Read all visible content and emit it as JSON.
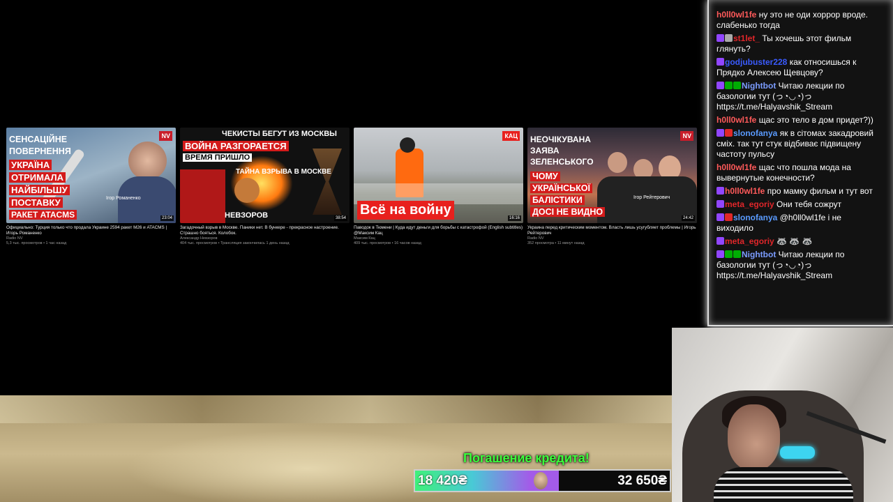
{
  "videos": [
    {
      "duration": "23:04",
      "badge": "NV",
      "thumb_lines": [
        "СЕНСАЦІЙНЕ",
        "ПОВЕРНЕННЯ",
        "УКРАЇНА",
        "ОТРИМАЛА",
        "НАЙБІЛЬШУ",
        "ПОСТАВКУ",
        "РАКЕТ ATACMS"
      ],
      "thumb_caption": "Ігор Романенко",
      "title": "Официально: Турция только что продала Украине 2594 ракет M26 и ATACMS | Игорь Романенко",
      "channel": "Radio NV",
      "meta": "5,3 тыс. просмотров • 1 час назад"
    },
    {
      "duration": "38:54",
      "thumb_lines": [
        "ЧЕКИСТЫ БЕГУТ ИЗ МОСКВЫ",
        "ВОЙНА РАЗГОРАЕТСЯ",
        "ВРЕМЯ ПРИШЛО",
        "ТАЙНА ВЗРЫВА В МОСКВЕ",
        "НЕВЗОРОВ"
      ],
      "title": "Загадочный взрыв в Москве. Паники нет. В бункере - прекрасное настроение. Страшно бояться. Колобок.",
      "channel": "Александр Невзоров",
      "meta": "404 тыс. просмотров • Трансляция закончилась 1 день назад"
    },
    {
      "duration": "16:16",
      "badge": "КАЦ",
      "thumb_lines": [
        "Всё на войну"
      ],
      "title": "Паводок в Тюмени | Куда идут деньги для борьбы с катастрофой (English subtitles) @Максим Кац",
      "channel": "Максим Кац",
      "meta": "409 тыс. просмотров • 16 часов назад"
    },
    {
      "duration": "24:42",
      "badge": "NV",
      "thumb_lines": [
        "НЕОЧІКУВАНА",
        "ЗАЯВА",
        "ЗЕЛЕНСЬКОГО",
        "ЧОМУ",
        "УКРАЇНСЬКОЇ",
        "БАЛІСТИКИ",
        "ДОСІ НЕ ВИДНО"
      ],
      "thumb_caption": "Ігор Рейтерович",
      "title": "Украина перед критическим моментом. Власть лишь усугубляет проблемы | Игорь Рейтерович",
      "channel": "Radio NV",
      "meta": "352 просмотра • 11 минут назад"
    }
  ],
  "chat": [
    {
      "user": "h0ll0wl1fe",
      "color": "#ff5a5a",
      "badges": [],
      "text": "ну это не оди хоррор вроде. слабенько тогда"
    },
    {
      "user": "st1let_",
      "color": "#e0262a",
      "badges": [
        "#9146ff",
        "#aaaaaa"
      ],
      "text": "Ты хочешь этот фильм глянуть?"
    },
    {
      "user": "godjubuster228",
      "color": "#3a5bff",
      "badges": [
        "#9146ff"
      ],
      "text": "как относишься к Прядко Алексею Щевцову?"
    },
    {
      "user": "Nightbot",
      "color": "#7b9cff",
      "badges": [
        "#9146ff",
        "#00ad03",
        "#00ad03"
      ],
      "text": "Читаю лекции по базологии тут (っ◔◡◔)っ https://t.me/Halyavshik_Stream"
    },
    {
      "user": "h0ll0wl1fe",
      "color": "#ff5a5a",
      "badges": [],
      "text": "щас это тело в дом придет?))"
    },
    {
      "user": "slonofanya",
      "color": "#5a9bff",
      "badges": [
        "#9146ff",
        "#e02828"
      ],
      "text": "як в сітомах закадровий сміх. так тут стук відбиває підвищену частоту пульсу"
    },
    {
      "user": "h0ll0wl1fe",
      "color": "#ff5a5a",
      "badges": [],
      "text": "щас что пошла мода на вывернутые конечности?"
    },
    {
      "user": "h0ll0wl1fe",
      "color": "#ff5a5a",
      "badges": [
        "#9146ff"
      ],
      "text": "про мамку фильм и тут вот"
    },
    {
      "user": "meta_egoriy",
      "color": "#e0262a",
      "badges": [
        "#9146ff"
      ],
      "text": "Они тебя сожрут"
    },
    {
      "user": "slonofanya",
      "color": "#5a9bff",
      "badges": [
        "#9146ff",
        "#e02828"
      ],
      "text": "@h0ll0wl1fe і не виходило"
    },
    {
      "user": "meta_egoriy",
      "color": "#e0262a",
      "badges": [
        "#9146ff"
      ],
      "text": "🦝 🦝 🦝"
    },
    {
      "user": "Nightbot",
      "color": "#7b9cff",
      "badges": [
        "#9146ff",
        "#00ad03",
        "#00ad03"
      ],
      "text": "Читаю лекции по базологии тут (っ◔◡◔)っ https://t.me/Halyavshik_Stream"
    }
  ],
  "credit": {
    "title": "Погашение кредита!",
    "current": "18 420₴",
    "goal": "32 650₴",
    "progress": 0.564
  }
}
